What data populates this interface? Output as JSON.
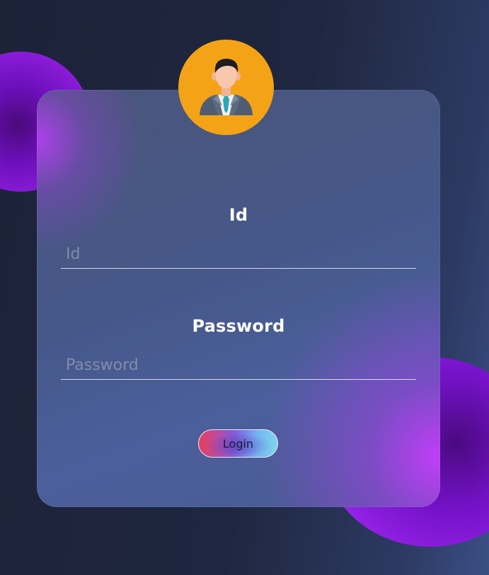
{
  "form": {
    "id_label": "Id",
    "id_placeholder": "Id",
    "password_label": "Password",
    "password_placeholder": "Password",
    "login_label": "Login"
  },
  "avatar": {
    "icon": "user-avatar-icon",
    "background_color": "#f4a316"
  },
  "colors": {
    "background": "#1f2740",
    "card": "#4a5b92",
    "accent_purple": "#9421e6"
  }
}
